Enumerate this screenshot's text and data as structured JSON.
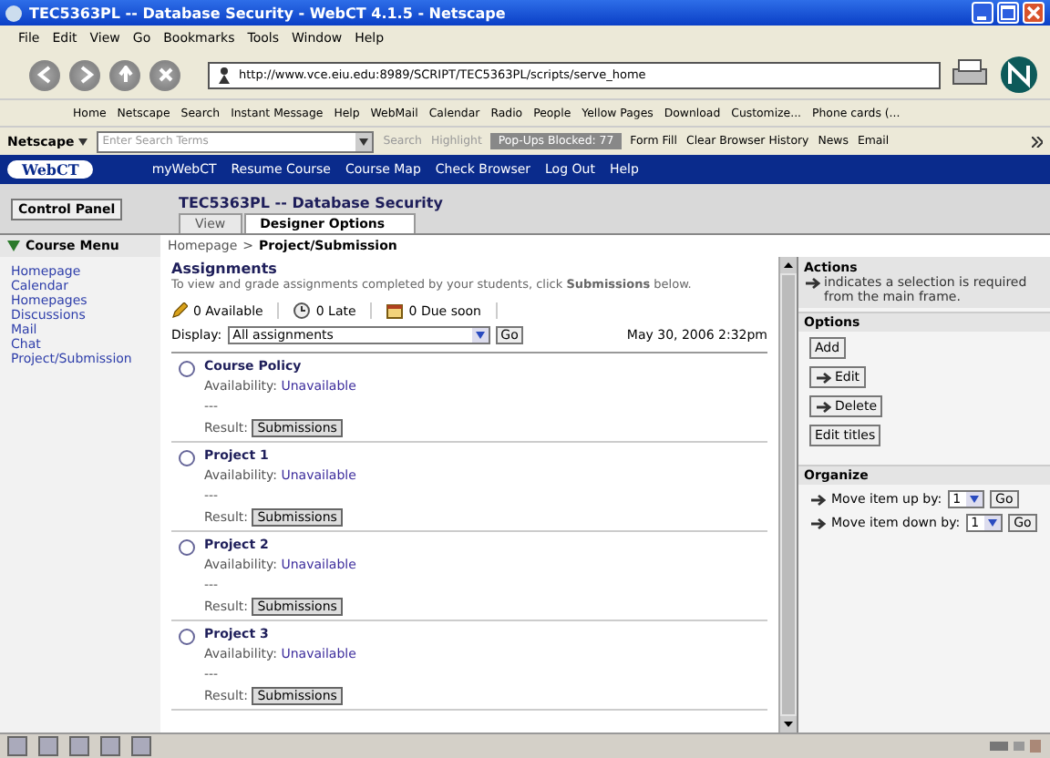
{
  "window": {
    "title": "TEC5363PL -- Database Security - WebCT 4.1.5 - Netscape"
  },
  "menu": [
    "File",
    "Edit",
    "View",
    "Go",
    "Bookmarks",
    "Tools",
    "Window",
    "Help"
  ],
  "address": {
    "value": "http://www.vce.eiu.edu:8989/SCRIPT/TEC5363PL/scripts/serve_home"
  },
  "personal_toolbar": [
    "Home",
    "Netscape",
    "Search",
    "Instant Message",
    "Help",
    "WebMail",
    "Calendar",
    "Radio",
    "People",
    "Yellow Pages",
    "Download",
    "Customize...",
    "Phone cards (..."
  ],
  "search_toolbar": {
    "brand": "Netscape",
    "placeholder": "Enter Search Terms",
    "search": "Search",
    "highlight": "Highlight",
    "popups": "Pop-Ups Blocked: 77",
    "items": [
      "Form Fill",
      "Clear Browser History",
      "News",
      "Email"
    ]
  },
  "webct_nav": [
    "myWebCT",
    "Resume Course",
    "Course Map",
    "Check Browser",
    "Log Out",
    "Help"
  ],
  "logo": "WebCT",
  "control_panel": "Control Panel",
  "course_title": "TEC5363PL -- Database Security",
  "tabs": [
    {
      "label": "View",
      "selected": false
    },
    {
      "label": "Designer Options",
      "selected": true
    }
  ],
  "course_menu": {
    "heading": "Course Menu",
    "items": [
      "Homepage",
      "Calendar",
      "Homepages",
      "Discussions",
      "Mail",
      "Chat",
      "Project/Submission"
    ]
  },
  "breadcrumb": {
    "parent": "Homepage",
    "separator": ">",
    "current": "Project/Submission"
  },
  "assignments": {
    "heading": "Assignments",
    "intro": "To view and grade assignments completed by your students, click **Submissions** below.",
    "counters": [
      "0 Available",
      "0 Late",
      "0 Due soon"
    ],
    "display_label": "Display:",
    "display_value": "All assignments",
    "go": "Go",
    "date": "May 30, 2006 2:32pm",
    "items": [
      {
        "title": "Course Policy",
        "selected": false,
        "availability_label": "Availability:",
        "availability": "Unavailable",
        "note": "---",
        "result_label": "Result:",
        "button": "Submissions"
      },
      {
        "title": "Project 1",
        "selected": false,
        "availability_label": "Availability:",
        "availability": "Unavailable",
        "note": "---",
        "result_label": "Result:",
        "button": "Submissions"
      },
      {
        "title": "Project 2",
        "selected": false,
        "availability_label": "Availability:",
        "availability": "Unavailable",
        "note": "---",
        "result_label": "Result:",
        "button": "Submissions"
      },
      {
        "title": "Project 3",
        "selected": false,
        "availability_label": "Availability:",
        "availability": "Unavailable",
        "note": "---",
        "result_label": "Result:",
        "button": "Submissions"
      }
    ]
  },
  "actions": {
    "heading": "Actions",
    "note": "indicates a selection is required from the main frame.",
    "options_heading": "Options",
    "buttons": [
      {
        "label": "Add",
        "needs_selection": false
      },
      {
        "label": "Edit",
        "needs_selection": true
      },
      {
        "label": "Delete",
        "needs_selection": true
      },
      {
        "label": "Edit titles",
        "needs_selection": false
      }
    ],
    "organize_heading": "Organize",
    "moves": [
      {
        "label": "Move item up by:",
        "value": "1",
        "go": "Go"
      },
      {
        "label": "Move item down by:",
        "value": "1",
        "go": "Go"
      }
    ]
  }
}
